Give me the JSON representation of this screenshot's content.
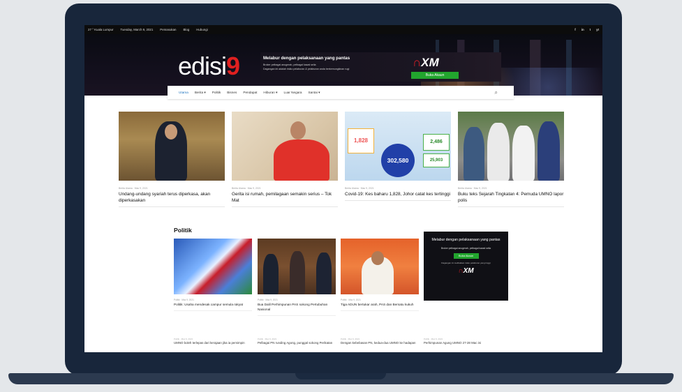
{
  "topbar": {
    "items": [
      "27 ° Kuala Lumpur",
      "Tuesday, March 9, 2021",
      "Pemasukan",
      "Blog",
      "Hubungi"
    ],
    "social": [
      "f",
      "in",
      "t",
      "yt"
    ]
  },
  "header": {
    "logo_text": "edisi",
    "logo_accent": "9",
    "ad": {
      "title": "Melabur dengan pelaksanaan yang pantas",
      "line1": "Broker pelbagai anugerah, pelbagai kawal selia",
      "line2": "Dagangan ini adalah risiko pelaburan & pelaburan anda berkemungkinan rugi",
      "brand": "XM",
      "cta": "Buka Akaun"
    }
  },
  "nav": {
    "items": [
      "Utama",
      "Berita ▾",
      "Politik",
      "Bisnes",
      "Pendapat",
      "Hiburan ▾",
      "Luar Negara",
      "Santai ▾"
    ],
    "search_icon": "search-icon"
  },
  "featured": [
    {
      "meta": "Berita Utama · Mac 9, 2021",
      "headline": "Undang-undang syariah terus diperkasa, akan diperkasakan"
    },
    {
      "meta": "Berita Utama · Mac 9, 2021",
      "headline": "Gerita isi rumah, pemilagaan semakin serius – Tok Mat"
    },
    {
      "meta": "Berita Utama · Mac 9, 2021",
      "headline": "Covid-19: Kes baharu 1,828, Johor catat kes tertinggi"
    },
    {
      "meta": "Berita Utama · Mac 9, 2021",
      "headline": "Buku teks Sejarah Tingkatan 4: Pemuda UMNO lapor polis"
    }
  ],
  "covid_graphic": {
    "new_cases": "1,828",
    "recovered": "2,486",
    "total": "302,580",
    "active": "25,903"
  },
  "politik": {
    "title": "Politik",
    "cards": [
      {
        "meta": "Politik · Mac 9, 2021",
        "text": "Politik: Usaha mendesak campur semula rakyat"
      },
      {
        "meta": "Politik · Mac 9, 2021",
        "text": "Bua Dalil Perhimpunan PAS sokong Pertubuhan Nasional"
      },
      {
        "meta": "Politik · Mac 9, 2021",
        "text": "Tiga ADUN bertukar arah, PAS dan Bersatu kukuh"
      }
    ],
    "side_ad": {
      "title": "Melabur dengan pelaksanaan yang pantas",
      "sub": "Broker pelbagai anugerah, pelbagai kawal selia",
      "cta": "Buka Akaun",
      "note": "Dagangan ini melibatkan risiko pelaburan yang tinggi",
      "brand": "XM"
    },
    "bottom": [
      {
        "meta": "Politik · Mac 9, 2021",
        "text": "UMNO boleh terlepas dari kerajaan jika ia pemimpin"
      },
      {
        "meta": "Politik · Mac 9, 2021",
        "text": "Pelbagai PN runding Agong, punggal sokong Perikatan"
      },
      {
        "meta": "Politik · Mac 9, 2021",
        "text": "Dengan kebebasan PN, kedua-dua UMNO ke hadapan"
      },
      {
        "meta": "Politik · Mac 9, 2021",
        "text": "Perhimpunan Agung UMNO 27-28 Mac ini"
      }
    ]
  }
}
